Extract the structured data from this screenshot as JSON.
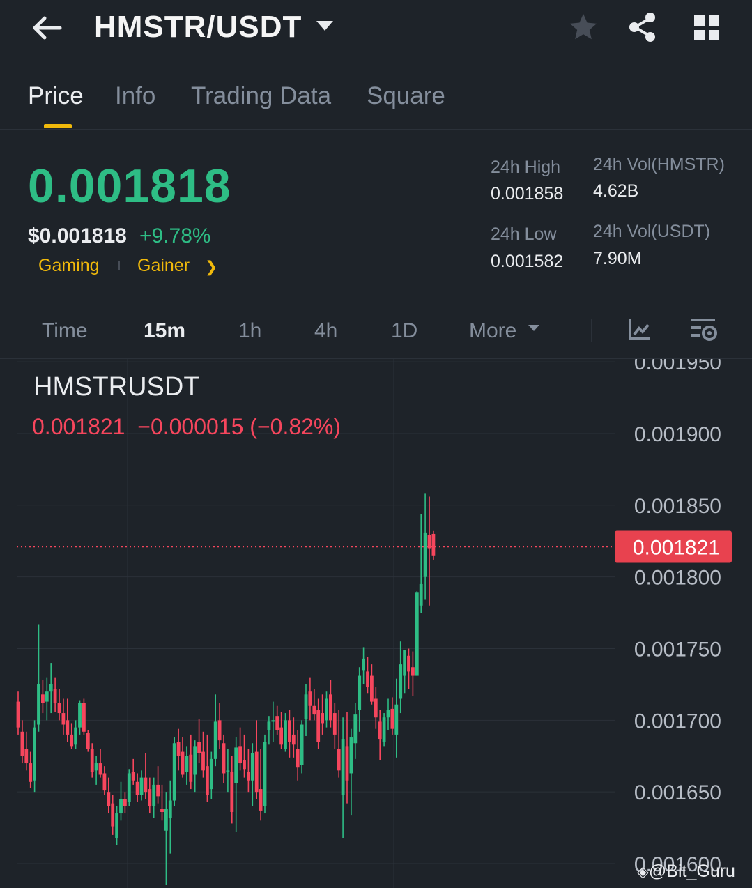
{
  "header": {
    "title": "HMSTR/USDT",
    "icons": [
      "back-arrow-icon",
      "dropdown-caret-icon",
      "star-icon",
      "share-icon",
      "grid-icon"
    ]
  },
  "tabs": [
    {
      "label": "Price",
      "active": true
    },
    {
      "label": "Info",
      "active": false
    },
    {
      "label": "Trading Data",
      "active": false
    },
    {
      "label": "Square",
      "active": false
    }
  ],
  "ticker": {
    "last_price": "0.001818",
    "usd_price": "$0.001818",
    "change_pct": "+9.78%",
    "tags": [
      "Gaming",
      "Gainer"
    ],
    "high_label": "24h High",
    "high_value": "0.001858",
    "low_label": "24h Low",
    "low_value": "0.001582",
    "vol_base_label": "24h Vol(HMSTR)",
    "vol_base_value": "4.62B",
    "vol_quote_label": "24h Vol(USDT)",
    "vol_quote_value": "7.90M"
  },
  "timeframes": {
    "items": [
      "Time",
      "15m",
      "1h",
      "4h",
      "1D",
      "More"
    ],
    "active": "15m"
  },
  "chart_legend": {
    "symbol": "HMSTRUSDT",
    "values": "0.001821  −0.000015 (−0.82%)"
  },
  "colors": {
    "up": "#2ebd85",
    "down": "#f6465d",
    "accent": "#f0b90b",
    "bg": "#1e2329"
  },
  "watermark": "@Bit_Guru",
  "chart_data": {
    "type": "candlestick",
    "y_ticks": [
      "0.001950",
      "0.001900",
      "0.001850",
      "0.001800",
      "0.001750",
      "0.001700",
      "0.001650",
      "0.001600"
    ],
    "ylim": [
      0.001583,
      0.001952
    ],
    "current_price_label": "0.001821",
    "current_price": 0.001821,
    "grid": true,
    "candles": [
      [
        0.001713,
        0.00172,
        0.00169,
        0.001695
      ],
      [
        0.001692,
        0.0017,
        0.00167,
        0.001675
      ],
      [
        0.00168,
        0.001692,
        0.001665,
        0.00167
      ],
      [
        0.00167,
        0.001678,
        0.001653,
        0.001657
      ],
      [
        0.001658,
        0.0017,
        0.00165,
        0.001695
      ],
      [
        0.001697,
        0.001767,
        0.001692,
        0.001725
      ],
      [
        0.001718,
        0.001728,
        0.001705,
        0.001712
      ],
      [
        0.001713,
        0.00173,
        0.0017,
        0.00172
      ],
      [
        0.00172,
        0.00174,
        0.001705,
        0.001725
      ],
      [
        0.001722,
        0.00173,
        0.001706,
        0.001712
      ],
      [
        0.001712,
        0.001722,
        0.0017,
        0.001705
      ],
      [
        0.001705,
        0.001715,
        0.00169,
        0.001697
      ],
      [
        0.0017,
        0.001715,
        0.001685,
        0.00169
      ],
      [
        0.00169,
        0.001698,
        0.00168,
        0.001682
      ],
      [
        0.001683,
        0.0017,
        0.00168,
        0.001695
      ],
      [
        0.001695,
        0.001714,
        0.00169,
        0.001712
      ],
      [
        0.001712,
        0.001715,
        0.00169,
        0.001692
      ],
      [
        0.001691,
        0.001693,
        0.001678,
        0.00168
      ],
      [
        0.00168,
        0.001684,
        0.00166,
        0.001664
      ],
      [
        0.001665,
        0.001675,
        0.001655,
        0.00167
      ],
      [
        0.00167,
        0.00168,
        0.00166,
        0.001662
      ],
      [
        0.001663,
        0.001668,
        0.001648,
        0.001651
      ],
      [
        0.00165,
        0.00166,
        0.001635,
        0.00164
      ],
      [
        0.001642,
        0.001648,
        0.00162,
        0.001626
      ],
      [
        0.001618,
        0.00164,
        0.001613,
        0.001635
      ],
      [
        0.001635,
        0.001657,
        0.00163,
        0.001645
      ],
      [
        0.001645,
        0.00165,
        0.001635,
        0.00164
      ],
      [
        0.001643,
        0.001666,
        0.00164,
        0.001663
      ],
      [
        0.001664,
        0.001673,
        0.001655,
        0.001658
      ],
      [
        0.001657,
        0.001663,
        0.001643,
        0.001648
      ],
      [
        0.001648,
        0.001665,
        0.001644,
        0.00166
      ],
      [
        0.00166,
        0.001677,
        0.001645,
        0.00165
      ],
      [
        0.001652,
        0.00166,
        0.001635,
        0.00164
      ],
      [
        0.00164,
        0.00166,
        0.001632,
        0.001655
      ],
      [
        0.001655,
        0.001668,
        0.001642,
        0.001647
      ],
      [
        0.001638,
        0.001655,
        0.00163,
        0.001636
      ],
      [
        0.001623,
        0.00165,
        0.001585,
        0.001638
      ],
      [
        0.001632,
        0.001658,
        0.001607,
        0.001644
      ],
      [
        0.001644,
        0.001688,
        0.00164,
        0.001684
      ],
      [
        0.001685,
        0.001694,
        0.001665,
        0.001675
      ],
      [
        0.001678,
        0.001688,
        0.00166,
        0.001662
      ],
      [
        0.001664,
        0.001682,
        0.001655,
        0.001675
      ],
      [
        0.001676,
        0.00169,
        0.001652,
        0.001657
      ],
      [
        0.001662,
        0.001686,
        0.00165,
        0.001682
      ],
      [
        0.001685,
        0.001701,
        0.00167,
        0.001677
      ],
      [
        0.001678,
        0.001692,
        0.00166,
        0.001665
      ],
      [
        0.001668,
        0.00169,
        0.001643,
        0.001648
      ],
      [
        0.001652,
        0.001678,
        0.001645,
        0.001673
      ],
      [
        0.001673,
        0.001718,
        0.001668,
        0.001699
      ],
      [
        0.0017,
        0.001712,
        0.00168,
        0.001686
      ],
      [
        0.001684,
        0.00169,
        0.001656,
        0.001663
      ],
      [
        0.001664,
        0.00168,
        0.00165,
        0.001665
      ],
      [
        0.001664,
        0.001675,
        0.001628,
        0.001636
      ],
      [
        0.001656,
        0.001688,
        0.001622,
        0.001681
      ],
      [
        0.001682,
        0.001695,
        0.001665,
        0.00167
      ],
      [
        0.001672,
        0.00169,
        0.00166,
        0.001666
      ],
      [
        0.001664,
        0.00168,
        0.00165,
        0.001658
      ],
      [
        0.001658,
        0.001684,
        0.00164,
        0.001677
      ],
      [
        0.001678,
        0.0017,
        0.001645,
        0.00165
      ],
      [
        0.001652,
        0.00168,
        0.00163,
        0.001637
      ],
      [
        0.00164,
        0.00169,
        0.001635,
        0.001685
      ],
      [
        0.001693,
        0.001703,
        0.001683,
        0.001699
      ],
      [
        0.001699,
        0.001713,
        0.001685,
        0.0017
      ],
      [
        0.001703,
        0.00171,
        0.00169,
        0.001693
      ],
      [
        0.001695,
        0.001706,
        0.00168,
        0.001683
      ],
      [
        0.00168,
        0.001705,
        0.001678,
        0.0017
      ],
      [
        0.0017,
        0.001707,
        0.001674,
        0.001685
      ],
      [
        0.00169,
        0.001702,
        0.001674,
        0.001683
      ],
      [
        0.00168,
        0.001693,
        0.001658,
        0.001667
      ],
      [
        0.001669,
        0.0017,
        0.001663,
        0.001697
      ],
      [
        0.001701,
        0.001725,
        0.001689,
        0.001718
      ],
      [
        0.00172,
        0.00173,
        0.0017,
        0.00171
      ],
      [
        0.00171,
        0.001722,
        0.0017,
        0.001704
      ],
      [
        0.001707,
        0.001715,
        0.00168,
        0.001685
      ],
      [
        0.001705,
        0.001718,
        0.00169,
        0.001698
      ],
      [
        0.0017,
        0.00172,
        0.001695,
        0.001715
      ],
      [
        0.001718,
        0.001728,
        0.001695,
        0.0017
      ],
      [
        0.001705,
        0.001712,
        0.00168,
        0.00169
      ],
      [
        0.00168,
        0.001707,
        0.00166,
        0.001665
      ],
      [
        0.001648,
        0.001702,
        0.001618,
        0.001687
      ],
      [
        0.001682,
        0.001706,
        0.001642,
        0.001658
      ],
      [
        0.001663,
        0.001694,
        0.001634,
        0.001688
      ],
      [
        0.001684,
        0.001712,
        0.001673,
        0.001704
      ],
      [
        0.001707,
        0.001737,
        0.001692,
        0.001731
      ],
      [
        0.001735,
        0.001751,
        0.001725,
        0.001743
      ],
      [
        0.001734,
        0.001744,
        0.001719,
        0.001723
      ],
      [
        0.001731,
        0.001739,
        0.001711,
        0.001713
      ],
      [
        0.001715,
        0.001723,
        0.001694,
        0.001702
      ],
      [
        0.001699,
        0.001707,
        0.001672,
        0.001687
      ],
      [
        0.001685,
        0.001705,
        0.001682,
        0.001702
      ],
      [
        0.001702,
        0.001715,
        0.001693,
        0.001707
      ],
      [
        0.001708,
        0.001716,
        0.00169,
        0.001694
      ],
      [
        0.00169,
        0.001729,
        0.001674,
        0.001711
      ],
      [
        0.001715,
        0.001755,
        0.001705,
        0.001739
      ],
      [
        0.001731,
        0.001749,
        0.001719,
        0.001749
      ],
      [
        0.001745,
        0.00175,
        0.001722,
        0.001734
      ],
      [
        0.001737,
        0.001748,
        0.001717,
        0.001731
      ],
      [
        0.001731,
        0.00179,
        0.001731,
        0.001789
      ],
      [
        0.00178,
        0.001844,
        0.001775,
        0.001795
      ],
      [
        0.0018,
        0.001858,
        0.001784,
        0.001831
      ],
      [
        0.001829,
        0.001856,
        0.00178,
        0.00182
      ],
      [
        0.00183,
        0.001832,
        0.001812,
        0.001815
      ]
    ]
  }
}
